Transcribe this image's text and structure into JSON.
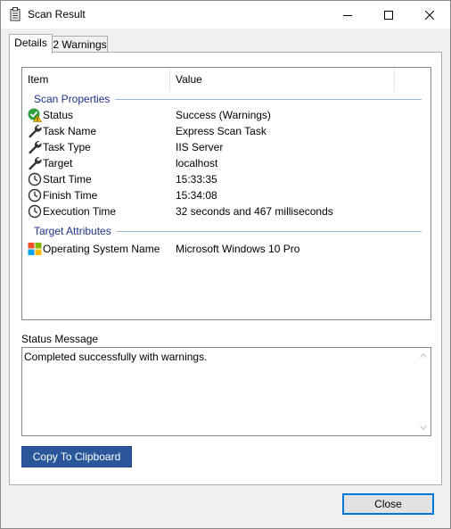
{
  "window": {
    "title": "Scan Result"
  },
  "tabs": [
    {
      "label": "Details",
      "active": true
    },
    {
      "label": "2 Warnings",
      "active": false
    }
  ],
  "list": {
    "columns": [
      "Item",
      "Value"
    ],
    "groups": [
      {
        "label": "Scan Properties",
        "rows": [
          {
            "icon": "success-warning-icon",
            "name": "Status",
            "value": "Success (Warnings)"
          },
          {
            "icon": "wrench-icon",
            "name": "Task Name",
            "value": "Express Scan Task"
          },
          {
            "icon": "wrench-icon",
            "name": "Task Type",
            "value": "IIS Server"
          },
          {
            "icon": "wrench-icon",
            "name": "Target",
            "value": "localhost"
          },
          {
            "icon": "clock-icon",
            "name": "Start Time",
            "value": "15:33:35"
          },
          {
            "icon": "clock-icon",
            "name": "Finish Time",
            "value": "15:34:08"
          },
          {
            "icon": "clock-icon",
            "name": "Execution Time",
            "value": "32 seconds and 467 milliseconds"
          }
        ]
      },
      {
        "label": "Target Attributes",
        "rows": [
          {
            "icon": "windows-logo-icon",
            "name": "Operating System Name",
            "value": "Microsoft Windows 10 Pro"
          }
        ]
      }
    ]
  },
  "status": {
    "label": "Status Message",
    "message": "Completed successfully with warnings."
  },
  "buttons": {
    "copy_label": "Copy To Clipboard",
    "close_label": "Close"
  },
  "colors": {
    "accent": "#2b579a",
    "group_header": "#1e3287",
    "focus_border": "#0078d7"
  }
}
